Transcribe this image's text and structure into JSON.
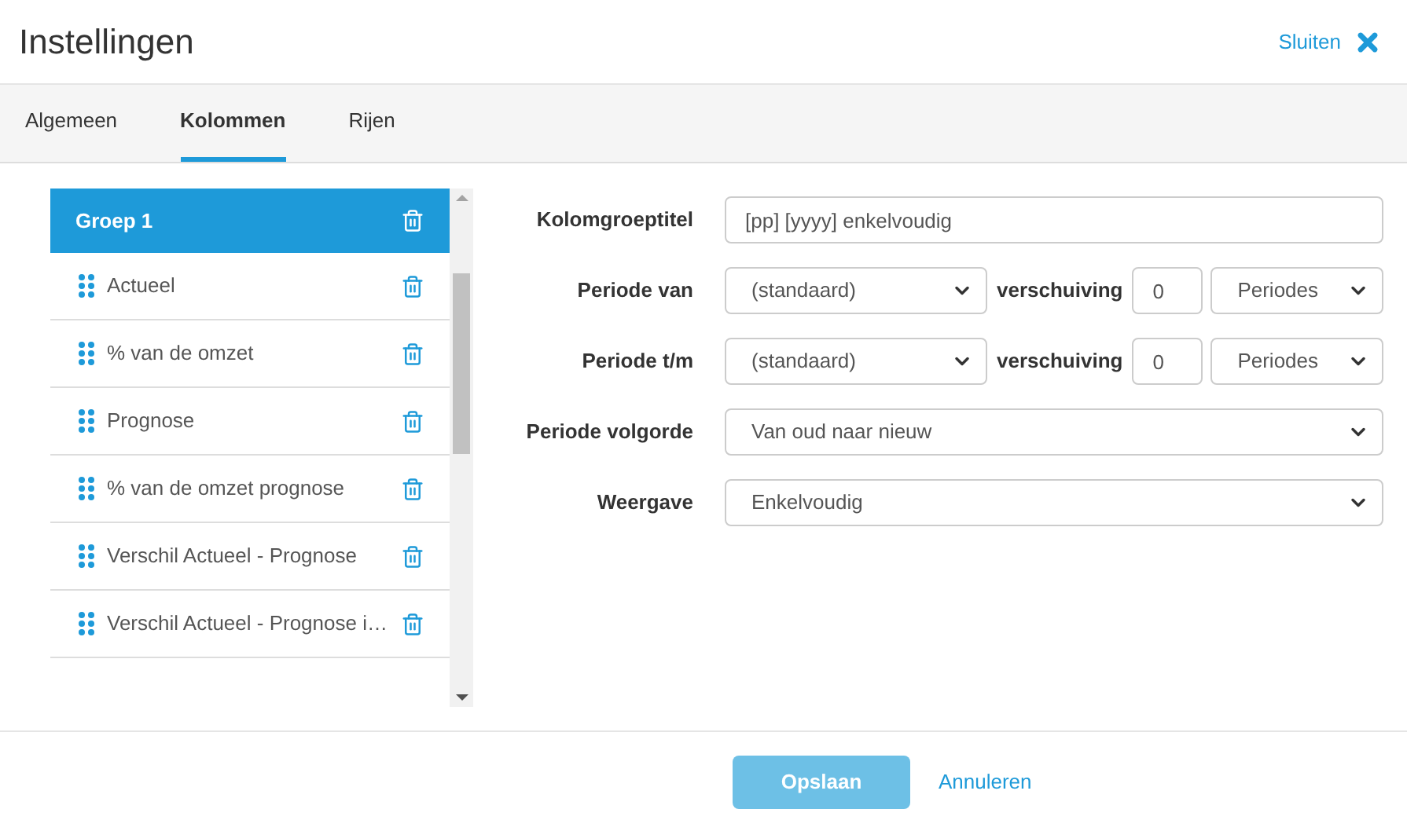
{
  "window": {
    "title": "Instellingen",
    "close_label": "Sluiten"
  },
  "tabs": [
    {
      "label": "Algemeen",
      "selected": false
    },
    {
      "label": "Kolommen",
      "selected": true
    },
    {
      "label": "Rijen",
      "selected": false
    }
  ],
  "list": {
    "group": {
      "label": "Groep 1",
      "selected": true
    },
    "items": [
      {
        "label": "Actueel",
        "selected": false
      },
      {
        "label": "% van de omzet",
        "selected": false
      },
      {
        "label": "Prognose",
        "selected": false
      },
      {
        "label": "% van de omzet prognose",
        "selected": false
      },
      {
        "label": "Verschil Actueel - Prognose",
        "selected": false
      },
      {
        "label": "Verschil Actueel - Prognose i…",
        "selected": false
      }
    ]
  },
  "form": {
    "title_field": {
      "label": "Kolomgroeptitel",
      "value": "[pp] [yyyy] enkelvoudig"
    },
    "period_rows": [
      {
        "label": "Periode van",
        "period": "(standaard)",
        "shift_label": "verschuiving",
        "shift": "0",
        "unit": "Periodes"
      },
      {
        "label": "Periode t/m",
        "period": "(standaard)",
        "shift_label": "verschuiving",
        "shift": "0",
        "unit": "Periodes"
      }
    ],
    "selects": [
      {
        "label": "Periode volgorde",
        "value": "Van oud naar nieuw"
      },
      {
        "label": "Weergave",
        "value": "Enkelvoudig"
      }
    ]
  },
  "footer": {
    "save": {
      "label": "Opslaan",
      "disabled": true
    },
    "cancel": "Annuleren"
  }
}
